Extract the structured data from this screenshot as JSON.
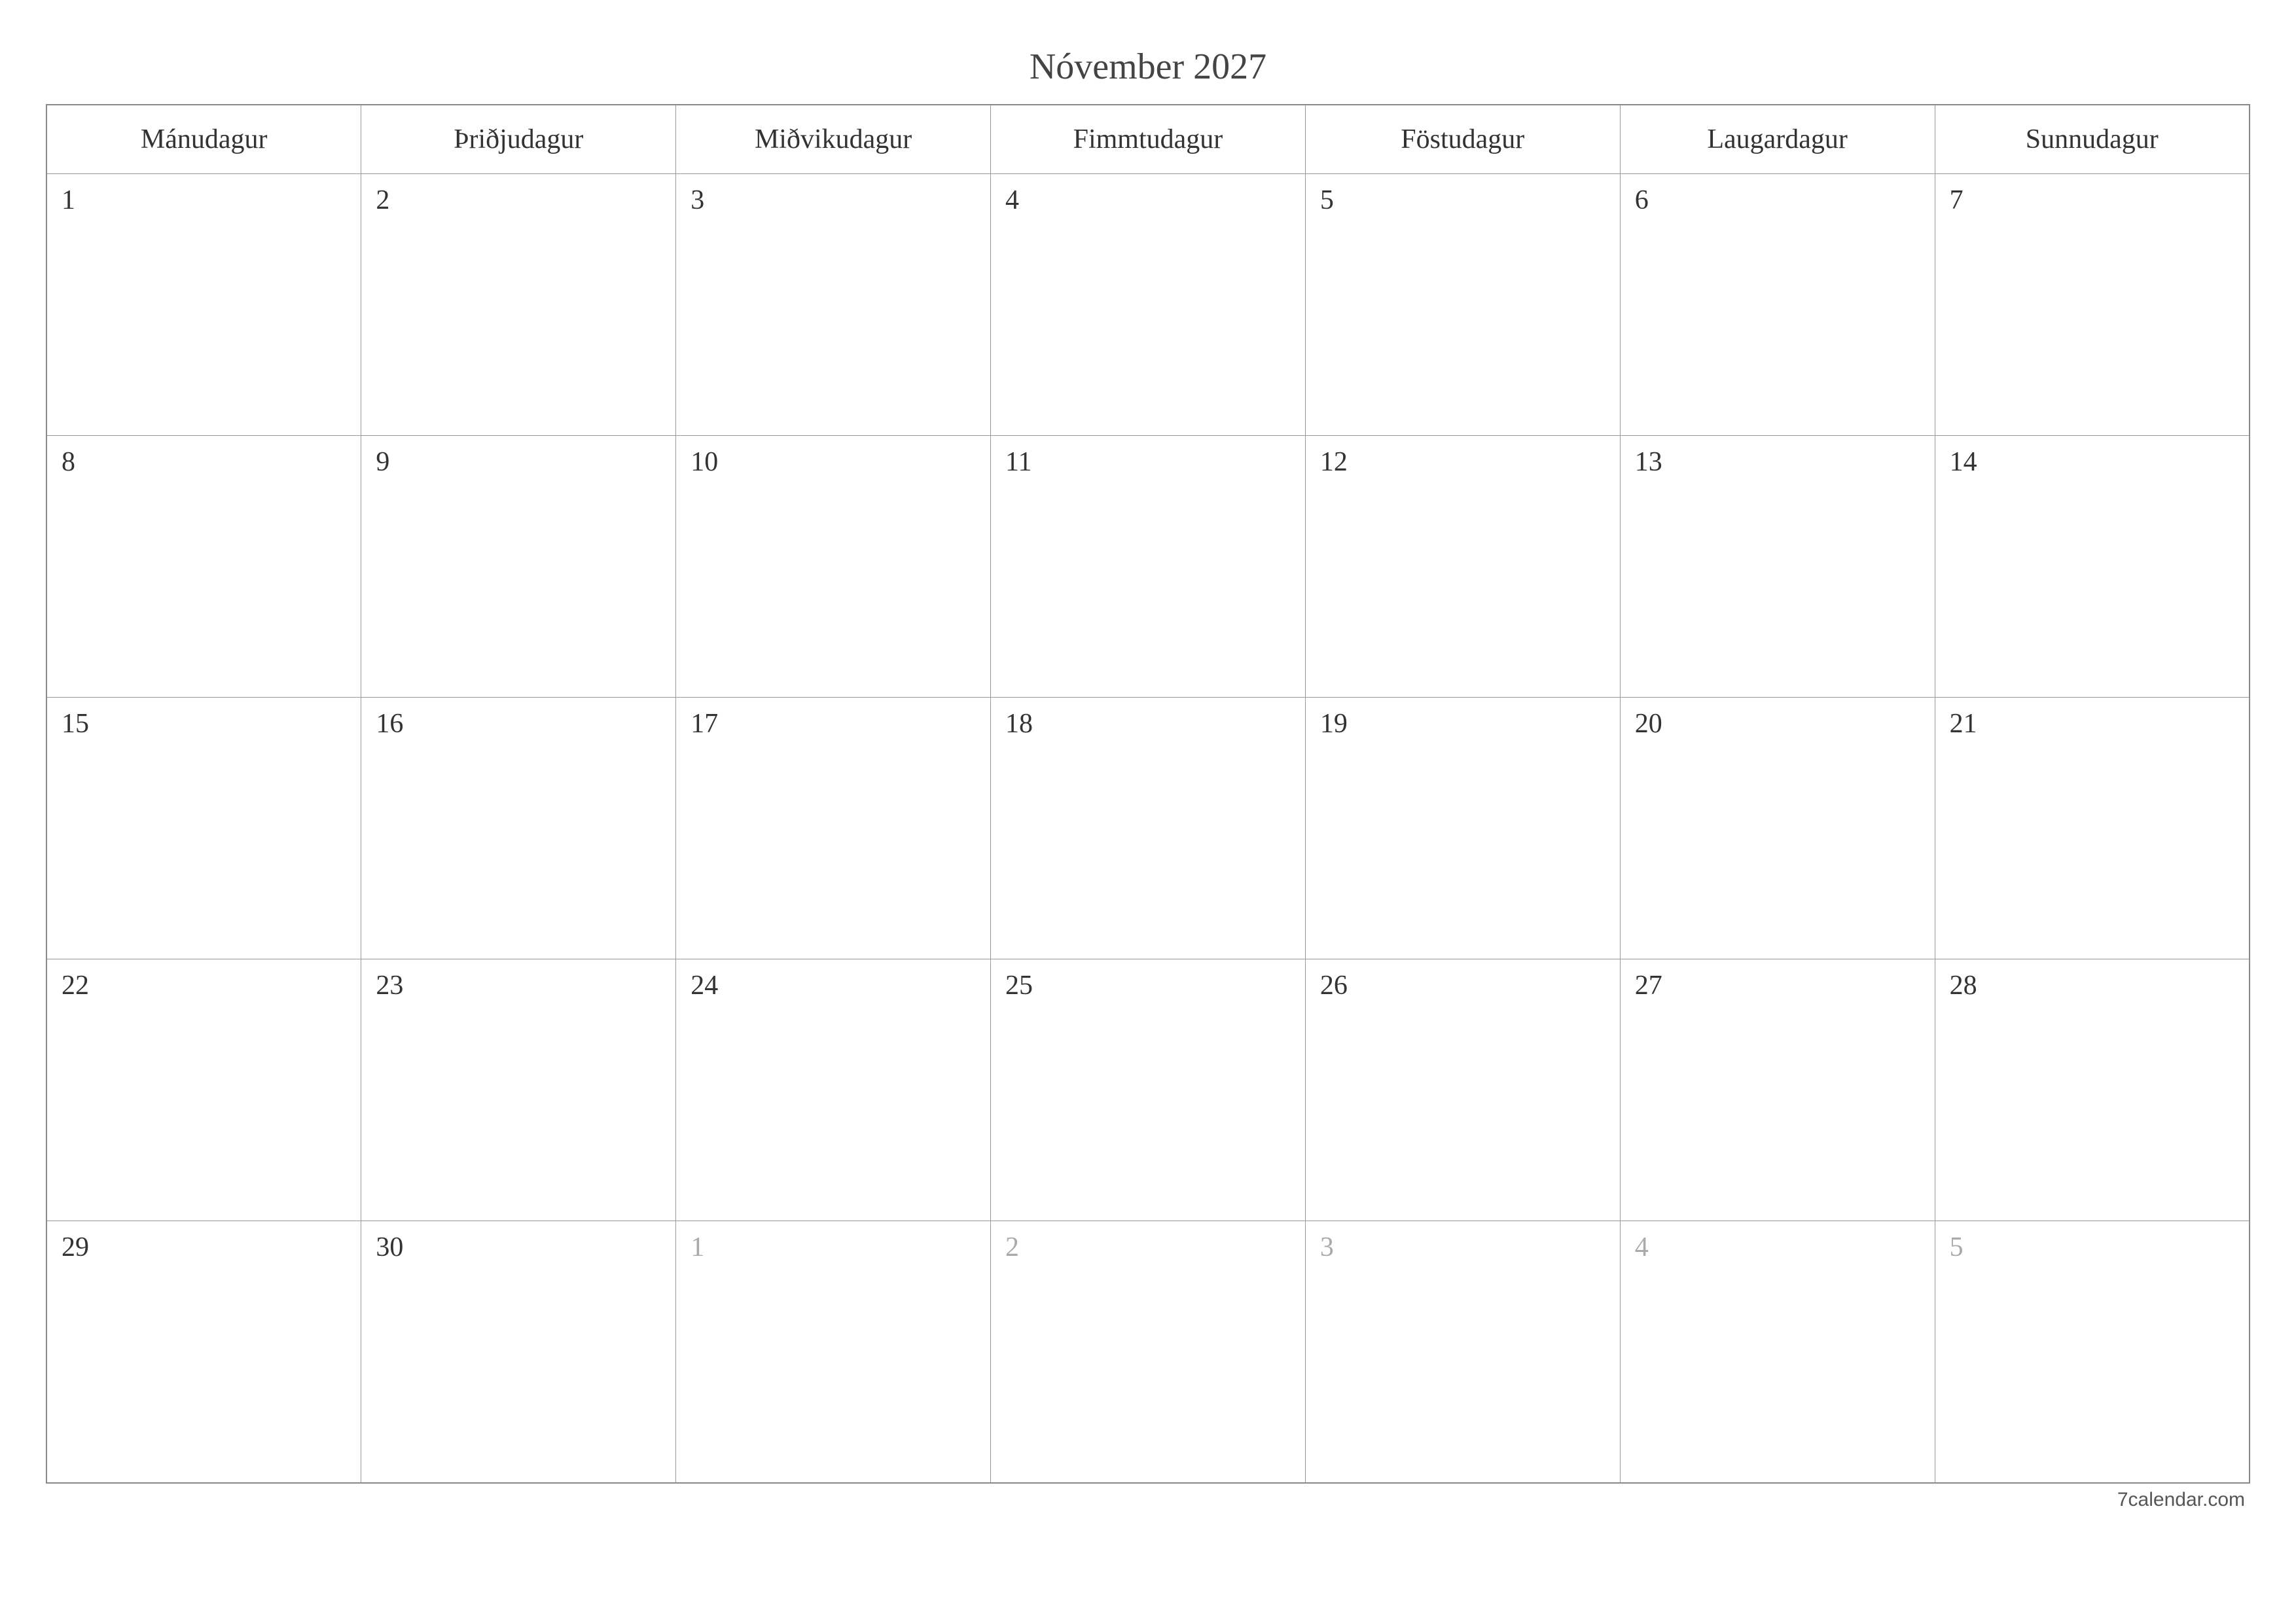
{
  "title": "Nóvember 2027",
  "weekdays": [
    "Mánudagur",
    "Þriðjudagur",
    "Miðvikudagur",
    "Fimmtudagur",
    "Föstudagur",
    "Laugardagur",
    "Sunnudagur"
  ],
  "weeks": [
    [
      {
        "day": "1",
        "muted": false
      },
      {
        "day": "2",
        "muted": false
      },
      {
        "day": "3",
        "muted": false
      },
      {
        "day": "4",
        "muted": false
      },
      {
        "day": "5",
        "muted": false
      },
      {
        "day": "6",
        "muted": false
      },
      {
        "day": "7",
        "muted": false
      }
    ],
    [
      {
        "day": "8",
        "muted": false
      },
      {
        "day": "9",
        "muted": false
      },
      {
        "day": "10",
        "muted": false
      },
      {
        "day": "11",
        "muted": false
      },
      {
        "day": "12",
        "muted": false
      },
      {
        "day": "13",
        "muted": false
      },
      {
        "day": "14",
        "muted": false
      }
    ],
    [
      {
        "day": "15",
        "muted": false
      },
      {
        "day": "16",
        "muted": false
      },
      {
        "day": "17",
        "muted": false
      },
      {
        "day": "18",
        "muted": false
      },
      {
        "day": "19",
        "muted": false
      },
      {
        "day": "20",
        "muted": false
      },
      {
        "day": "21",
        "muted": false
      }
    ],
    [
      {
        "day": "22",
        "muted": false
      },
      {
        "day": "23",
        "muted": false
      },
      {
        "day": "24",
        "muted": false
      },
      {
        "day": "25",
        "muted": false
      },
      {
        "day": "26",
        "muted": false
      },
      {
        "day": "27",
        "muted": false
      },
      {
        "day": "28",
        "muted": false
      }
    ],
    [
      {
        "day": "29",
        "muted": false
      },
      {
        "day": "30",
        "muted": false
      },
      {
        "day": "1",
        "muted": true
      },
      {
        "day": "2",
        "muted": true
      },
      {
        "day": "3",
        "muted": true
      },
      {
        "day": "4",
        "muted": true
      },
      {
        "day": "5",
        "muted": true
      }
    ]
  ],
  "footer": "7calendar.com"
}
